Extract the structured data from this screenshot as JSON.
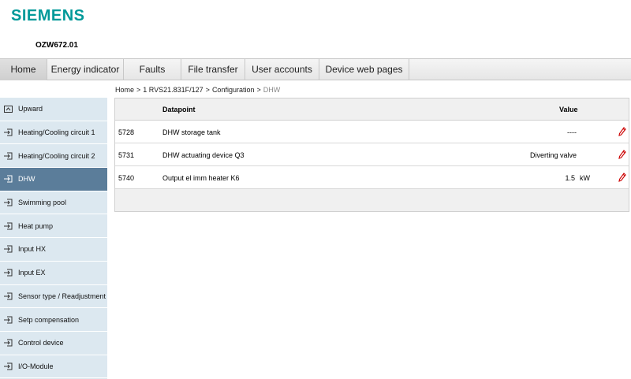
{
  "brand": {
    "logo": "SIEMENS",
    "device": "OZW672.01",
    "accent": "#009999"
  },
  "nav": {
    "tabs": [
      {
        "label": "Home",
        "active": true
      },
      {
        "label": "Energy indicator"
      },
      {
        "label": "Faults"
      },
      {
        "label": "File transfer"
      },
      {
        "label": "User accounts"
      },
      {
        "label": "Device web pages"
      }
    ]
  },
  "breadcrumb": {
    "items": [
      "Home",
      "1 RVS21.831F/127",
      "Configuration"
    ],
    "separator": ">",
    "current": "DHW"
  },
  "sidebar": {
    "items": [
      {
        "label": "Upward",
        "icon": "folder-up-icon"
      },
      {
        "label": "Heating/Cooling circuit 1",
        "icon": "enter-icon"
      },
      {
        "label": "Heating/Cooling circuit 2",
        "icon": "enter-icon"
      },
      {
        "label": "DHW",
        "icon": "enter-icon",
        "active": true
      },
      {
        "label": "Swimming pool",
        "icon": "enter-icon"
      },
      {
        "label": "Heat pump",
        "icon": "enter-icon"
      },
      {
        "label": "Input HX",
        "icon": "enter-icon"
      },
      {
        "label": "Input EX",
        "icon": "enter-icon"
      },
      {
        "label": "Sensor type / Readjustment",
        "icon": "enter-icon"
      },
      {
        "label": "Setp compensation",
        "icon": "enter-icon"
      },
      {
        "label": "Control device",
        "icon": "enter-icon"
      },
      {
        "label": "I/O-Module",
        "icon": "enter-icon"
      }
    ]
  },
  "table": {
    "headers": {
      "datapoint": "Datapoint",
      "value": "Value"
    },
    "rows": [
      {
        "id": "5728",
        "datapoint": "DHW storage tank",
        "value": "----",
        "unit": ""
      },
      {
        "id": "5731",
        "datapoint": "DHW actuating device Q3",
        "value": "Diverting valve",
        "unit": ""
      },
      {
        "id": "5740",
        "datapoint": "Output el imm heater K6",
        "value": "1.5",
        "unit": "kW"
      }
    ],
    "edit_icon": "pencil-icon",
    "edit_color": "#cc0000"
  }
}
